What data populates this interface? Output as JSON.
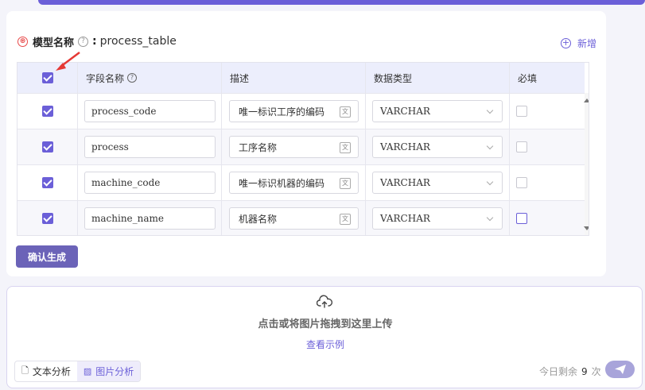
{
  "model": {
    "required_mark": "⊛",
    "label": "模型名称",
    "colon": ":",
    "value": "process_table"
  },
  "add_button": {
    "label": "新增"
  },
  "table": {
    "headers": {
      "field_name": "字段名称",
      "description": "描述",
      "data_type": "数据类型",
      "required": "必填"
    },
    "header_select_all_checked": true,
    "rows": [
      {
        "selected": true,
        "field_name": "process_code",
        "description": "唯一标识工序的编码",
        "data_type": "VARCHAR",
        "required": false
      },
      {
        "selected": true,
        "field_name": "process",
        "description": "工序名称",
        "data_type": "VARCHAR",
        "required": false
      },
      {
        "selected": true,
        "field_name": "machine_code",
        "description": "唯一标识机器的编码",
        "data_type": "VARCHAR",
        "required": false
      },
      {
        "selected": true,
        "field_name": "machine_name",
        "description": "机器名称",
        "data_type": "VARCHAR",
        "required": false
      }
    ]
  },
  "confirm_button": {
    "label": "确认生成"
  },
  "upload": {
    "prompt": "点击或将图片拖拽到这里上传",
    "example_link": "查看示例"
  },
  "modes": {
    "text": "文本分析",
    "image": "图片分析",
    "active": "image"
  },
  "quota": {
    "prefix": "今日剩余",
    "count": "9",
    "suffix": "次"
  },
  "colors": {
    "accent": "#6b5fd8",
    "button": "#6b63b8",
    "required": "#e84a4a",
    "annotation_arrow": "#e53935"
  }
}
